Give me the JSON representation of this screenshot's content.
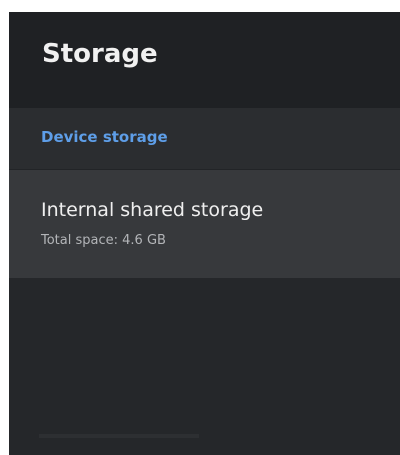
{
  "header": {
    "title": "Storage"
  },
  "section": {
    "label": "Device storage"
  },
  "items": [
    {
      "title": "Internal shared storage",
      "subtitle": "Total space: 4.6 GB"
    }
  ],
  "colors": {
    "background": "#25272a",
    "header_background": "#1f2124",
    "section_background": "#2b2d30",
    "accent": "#5e9ee8",
    "selected_item_background": "#37393c",
    "primary_text": "#efefef",
    "secondary_text": "#b3b5b8"
  }
}
